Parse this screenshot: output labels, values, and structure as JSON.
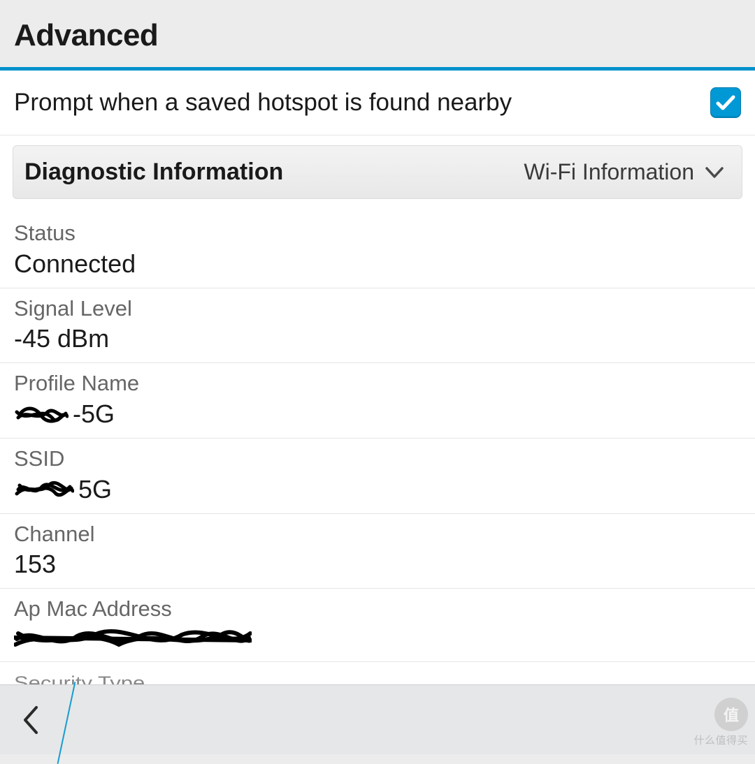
{
  "header": {
    "title": "Advanced"
  },
  "toggle": {
    "label": "Prompt when a saved hotspot is found nearby",
    "checked": true
  },
  "section": {
    "title": "Diagnostic Information",
    "dropdown_label": "Wi-Fi Information"
  },
  "info": {
    "status": {
      "label": "Status",
      "value": "Connected"
    },
    "signal": {
      "label": "Signal Level",
      "value": "-45 dBm"
    },
    "profile": {
      "label": "Profile Name",
      "value_suffix": "-5G"
    },
    "ssid": {
      "label": "SSID",
      "value_suffix": "5G"
    },
    "channel": {
      "label": "Channel",
      "value": "153"
    },
    "ap_mac": {
      "label": "Ap Mac Address"
    },
    "security": {
      "label": "Security Type"
    }
  },
  "watermark": {
    "badge": "值",
    "text": "什么值得买"
  }
}
